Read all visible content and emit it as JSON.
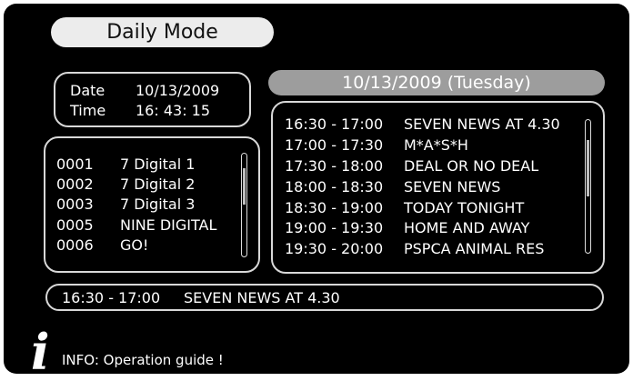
{
  "title": "Daily Mode",
  "datetime": {
    "date_label": "Date",
    "date_value": "10/13/2009",
    "time_label": "Time",
    "time_value": "16: 43: 15"
  },
  "channels": [
    {
      "num": "0001",
      "name": "7 Digital 1"
    },
    {
      "num": "0002",
      "name": "7 Digital 2"
    },
    {
      "num": "0003",
      "name": "7 Digital 3"
    },
    {
      "num": "0005",
      "name": "NINE DIGITAL"
    },
    {
      "num": "0006",
      "name": "GO!"
    }
  ],
  "schedule_header": "10/13/2009 (Tuesday)",
  "schedule": [
    {
      "time": "16:30 - 17:00",
      "program": "SEVEN NEWS AT 4.30"
    },
    {
      "time": "17:00 - 17:30",
      "program": "M*A*S*H"
    },
    {
      "time": "17:30 - 18:00",
      "program": "DEAL OR NO DEAL"
    },
    {
      "time": "18:00 - 18:30",
      "program": "SEVEN NEWS"
    },
    {
      "time": "18:30 - 19:00",
      "program": "TODAY TONIGHT"
    },
    {
      "time": "19:00 - 19:30",
      "program": "HOME AND AWAY"
    },
    {
      "time": "19:30 - 20:00",
      "program": "PSPCA ANIMAL RES"
    }
  ],
  "now_playing": {
    "time": "16:30 - 17:00",
    "program": "SEVEN NEWS AT 4.30"
  },
  "info": {
    "icon": "i",
    "text": "INFO: Operation guide !"
  }
}
